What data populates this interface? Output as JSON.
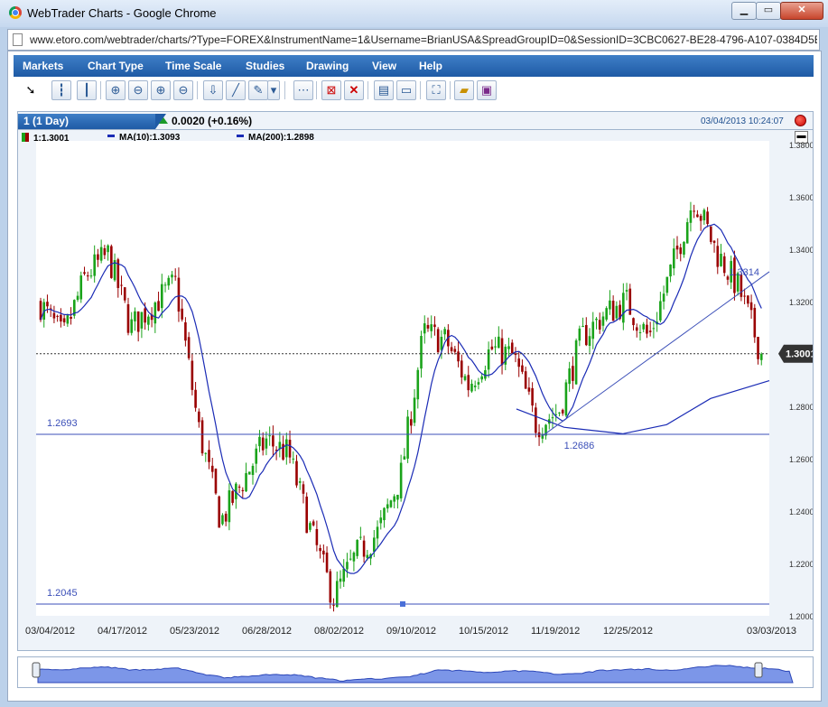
{
  "window": {
    "title": "WebTrader Charts - Google Chrome",
    "minimize": "▁",
    "maximize": "▭",
    "close": "✕"
  },
  "address": {
    "url": "www.etoro.com/webtrader/charts/?Type=FOREX&InstrumentName=1&Username=BrianUSA&SpreadGroupID=0&SessionID=3CBC0627-BE28-4796-A107-0384D5EA1"
  },
  "menu": {
    "items": [
      "Markets",
      "Chart Type",
      "Time Scale",
      "Studies",
      "Drawing",
      "View",
      "Help"
    ]
  },
  "toolbar": {
    "icons": [
      "pointer-icon",
      "bar-chart-icon",
      "candlestick-icon",
      "zoom-in-icon",
      "zoom-out-icon",
      "zoom-in-alt-icon",
      "zoom-out-alt-icon",
      "download-icon",
      "line-tool-icon",
      "pencil-icon",
      "dropdown-icon",
      "crosshair-icon",
      "delete-box-icon",
      "delete-icon",
      "print-icon",
      "screen-icon",
      "fullscreen-icon",
      "folder-icon",
      "save-icon"
    ]
  },
  "chart_tab": {
    "label": "1 (1 Day)",
    "change": "0.0020 (+0.16%)",
    "timestamp": "03/04/2013 10:24:07"
  },
  "legend": {
    "price": "1:1.3001",
    "ma10": "MA(10):1.3093",
    "ma200": "MA(200):1.2898"
  },
  "colors": {
    "up": "#1aa31a",
    "down": "#9a0000",
    "ma": "#1a2bb5",
    "accent": "#1e5aa5",
    "current_price_badge": "#333333"
  },
  "chart_data": {
    "type": "candlestick",
    "instrument": "FOREX 1",
    "title": "",
    "xlabel": "",
    "ylabel": "",
    "x_ticks": [
      "03/04/2012",
      "04/17/2012",
      "05/23/2012",
      "06/28/2012",
      "08/02/2012",
      "09/10/2012",
      "10/15/2012",
      "11/19/2012",
      "12/25/2012",
      "03/03/2013"
    ],
    "y_ticks": [
      "1.3800",
      "1.3600",
      "1.3400",
      "1.3200",
      "1.3000",
      "1.2800",
      "1.2600",
      "1.2400",
      "1.2200",
      "1.2000"
    ],
    "ylim": [
      1.2,
      1.38
    ],
    "grid": false,
    "current_price": 1.3001,
    "current_price_label": "1.3001",
    "annotations": [
      {
        "text": "1.2693",
        "value": 1.2693
      },
      {
        "text": "1.2686",
        "value": 1.2686
      },
      {
        "text": "1.2045",
        "value": 1.2045
      },
      {
        "text": "1.3314",
        "value": 1.3314
      }
    ],
    "close_series": [
      {
        "date": "03/04/2012",
        "close": 1.319
      },
      {
        "date": "03/15/2012",
        "close": 1.306
      },
      {
        "date": "03/28/2012",
        "close": 1.33
      },
      {
        "date": "04/05/2012",
        "close": 1.338
      },
      {
        "date": "04/17/2012",
        "close": 1.31
      },
      {
        "date": "04/26/2012",
        "close": 1.319
      },
      {
        "date": "05/03/2012",
        "close": 1.327
      },
      {
        "date": "05/23/2012",
        "close": 1.272
      },
      {
        "date": "06/01/2012",
        "close": 1.236
      },
      {
        "date": "06/08/2012",
        "close": 1.252
      },
      {
        "date": "06/20/2012",
        "close": 1.267
      },
      {
        "date": "06/28/2012",
        "close": 1.262
      },
      {
        "date": "07/09/2012",
        "close": 1.232
      },
      {
        "date": "07/24/2012",
        "close": 1.207
      },
      {
        "date": "08/02/2012",
        "close": 1.223
      },
      {
        "date": "08/15/2012",
        "close": 1.232
      },
      {
        "date": "08/28/2012",
        "close": 1.254
      },
      {
        "date": "09/10/2012",
        "close": 1.308
      },
      {
        "date": "09/18/2012",
        "close": 1.305
      },
      {
        "date": "09/28/2012",
        "close": 1.288
      },
      {
        "date": "10/15/2012",
        "close": 1.302
      },
      {
        "date": "10/29/2012",
        "close": 1.299
      },
      {
        "date": "11/09/2012",
        "close": 1.273
      },
      {
        "date": "11/19/2012",
        "close": 1.278
      },
      {
        "date": "12/03/2012",
        "close": 1.306
      },
      {
        "date": "12/17/2012",
        "close": 1.315
      },
      {
        "date": "12/25/2012",
        "close": 1.32
      },
      {
        "date": "01/08/2013",
        "close": 1.306
      },
      {
        "date": "01/18/2013",
        "close": 1.332
      },
      {
        "date": "02/01/2013",
        "close": 1.36
      },
      {
        "date": "02/14/2013",
        "close": 1.339
      },
      {
        "date": "02/22/2013",
        "close": 1.325
      },
      {
        "date": "03/03/2013",
        "close": 1.3001
      }
    ],
    "series": [
      {
        "name": "MA(10)",
        "value": 1.3093
      },
      {
        "name": "MA(200)",
        "value": 1.2898
      }
    ]
  }
}
